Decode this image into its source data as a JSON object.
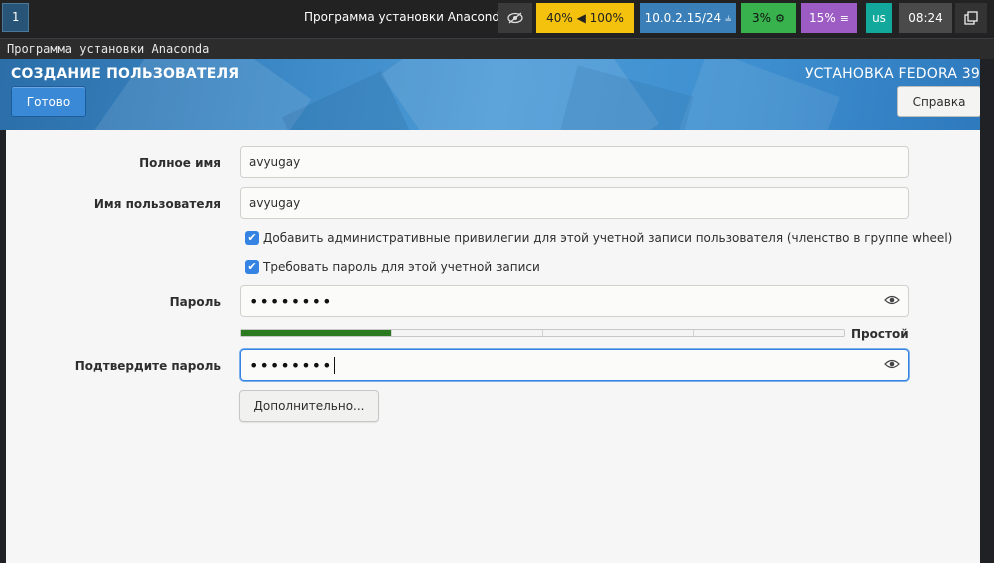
{
  "statusbar": {
    "workspace": "1",
    "window_title": "Программа установки Anaconda",
    "volume": "40% ◀ 100%",
    "network": "10.0.2.15/24",
    "network_icon": "wired-icon",
    "cpu": "3%",
    "memory": "15%",
    "keyboard": "us",
    "clock": "08:24",
    "colors": {
      "volume": "#f4c20d",
      "network": "#3a7fb8",
      "cpu": "#37b24d",
      "memory": "#9d5cc4",
      "keyboard": "#12a89b"
    }
  },
  "window": {
    "title": "Программа установки Anaconda"
  },
  "header": {
    "spoke_title": "СОЗДАНИЕ ПОЛЬЗОВАТЕЛЯ",
    "product_title": "УСТАНОВКА FEDORA 39",
    "done_label": "Готово",
    "help_label": "Справка"
  },
  "form": {
    "fullname_label": "Полное имя",
    "fullname_value": "avyugay",
    "username_label": "Имя пользователя",
    "username_value": "avyugay",
    "admin_checkbox_label": "Добавить административные привилегии для этой учетной записи пользователя (членство в группе wheel)",
    "admin_checked": true,
    "require_password_label": "Требовать пароль для этой учетной записи",
    "require_password_checked": true,
    "password_label": "Пароль",
    "password_value": "••••••••",
    "confirm_label": "Подтвердите пароль",
    "confirm_value": "••••••••",
    "strength_label": "Простой",
    "strength_level": 1,
    "strength_segments": 4,
    "advanced_label": "Дополнительно...",
    "checkmark": "✔",
    "eye_icon_glyph": "👁"
  }
}
